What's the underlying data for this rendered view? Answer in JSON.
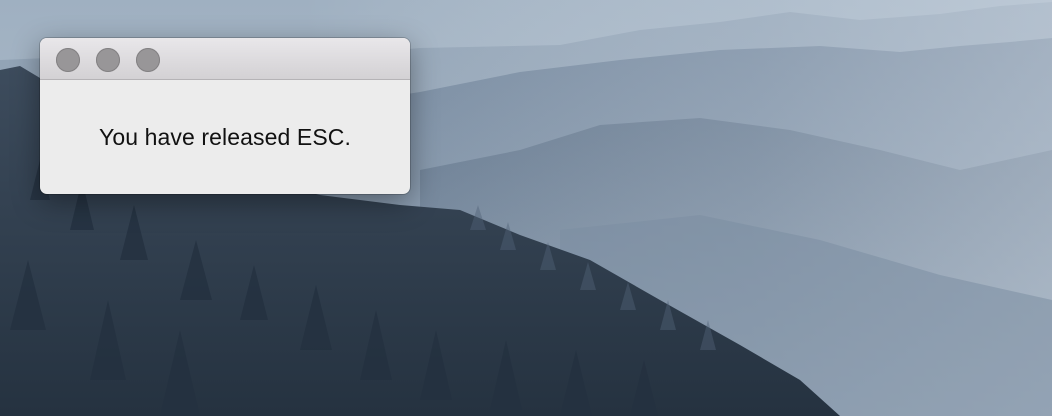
{
  "window": {
    "controls": [
      {
        "name": "close-button",
        "icon": "traffic-light-close-icon"
      },
      {
        "name": "minimize-button",
        "icon": "traffic-light-minimize-icon"
      },
      {
        "name": "zoom-button",
        "icon": "traffic-light-zoom-icon"
      }
    ],
    "message": "You have released ESC."
  },
  "desktop": {
    "wallpaper": "misty-forest-mountains",
    "colors": {
      "sky": "#a9b7c6",
      "distant_ridge": "#8ea0b4",
      "mid_ridge": "#70849b",
      "forest": "#2e3b4a"
    }
  },
  "theme": {
    "window_bg": "#ececec",
    "titlebar_top": "#e9e7ea",
    "titlebar_bottom": "#d3d1d4",
    "traffic_light_inactive": "#989698"
  }
}
